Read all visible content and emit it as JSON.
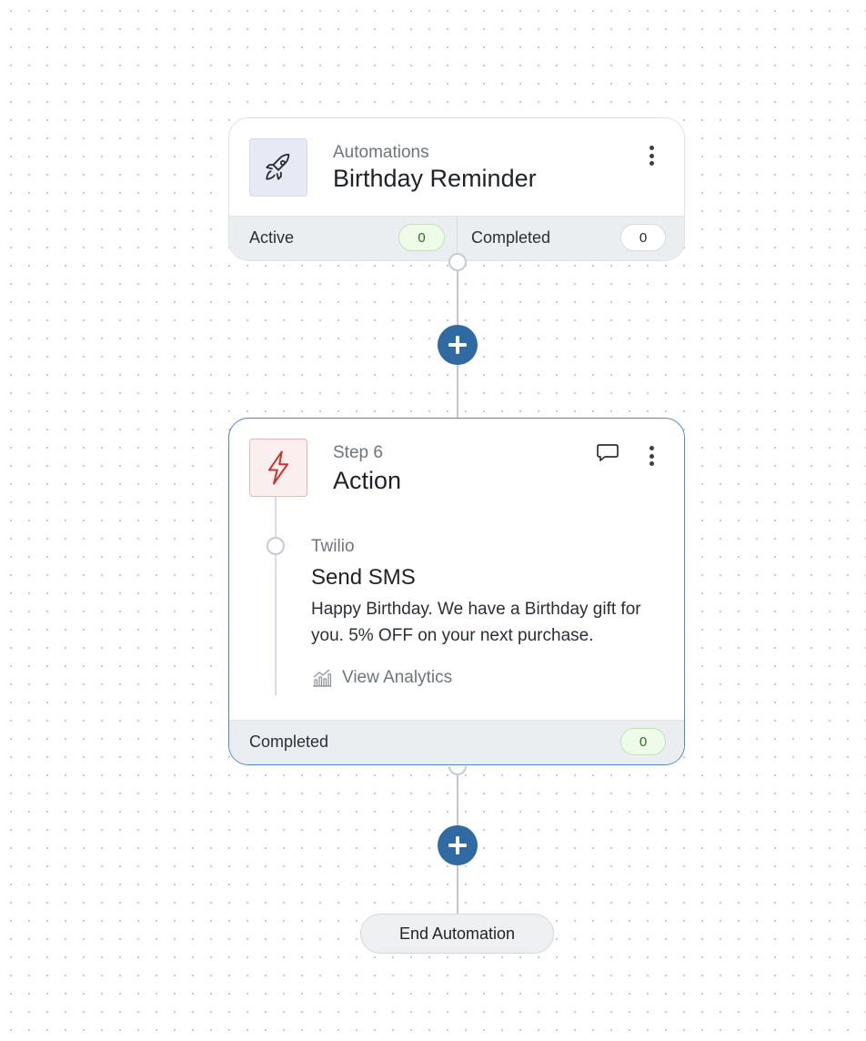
{
  "trigger_card": {
    "eyebrow": "Automations",
    "title": "Birthday Reminder",
    "icon": "rocket-icon",
    "stats": {
      "active_label": "Active",
      "active_count": "0",
      "completed_label": "Completed",
      "completed_count": "0"
    }
  },
  "action_card": {
    "eyebrow": "Step 6",
    "title": "Action",
    "icon": "lightning-bolt-icon",
    "sub_step": {
      "provider": "Twilio",
      "name": "Send SMS",
      "message": "Happy Birthday. We have a Birthday gift for you. 5% OFF on your next purchase.",
      "analytics_label": "View Analytics"
    },
    "stats": {
      "completed_label": "Completed",
      "completed_count": "0"
    }
  },
  "end_button": {
    "label": "End Automation"
  },
  "colors": {
    "accent_blue": "#2f6aa3",
    "bolt_red": "#c8372b",
    "success_green": "#2e6b1f"
  }
}
